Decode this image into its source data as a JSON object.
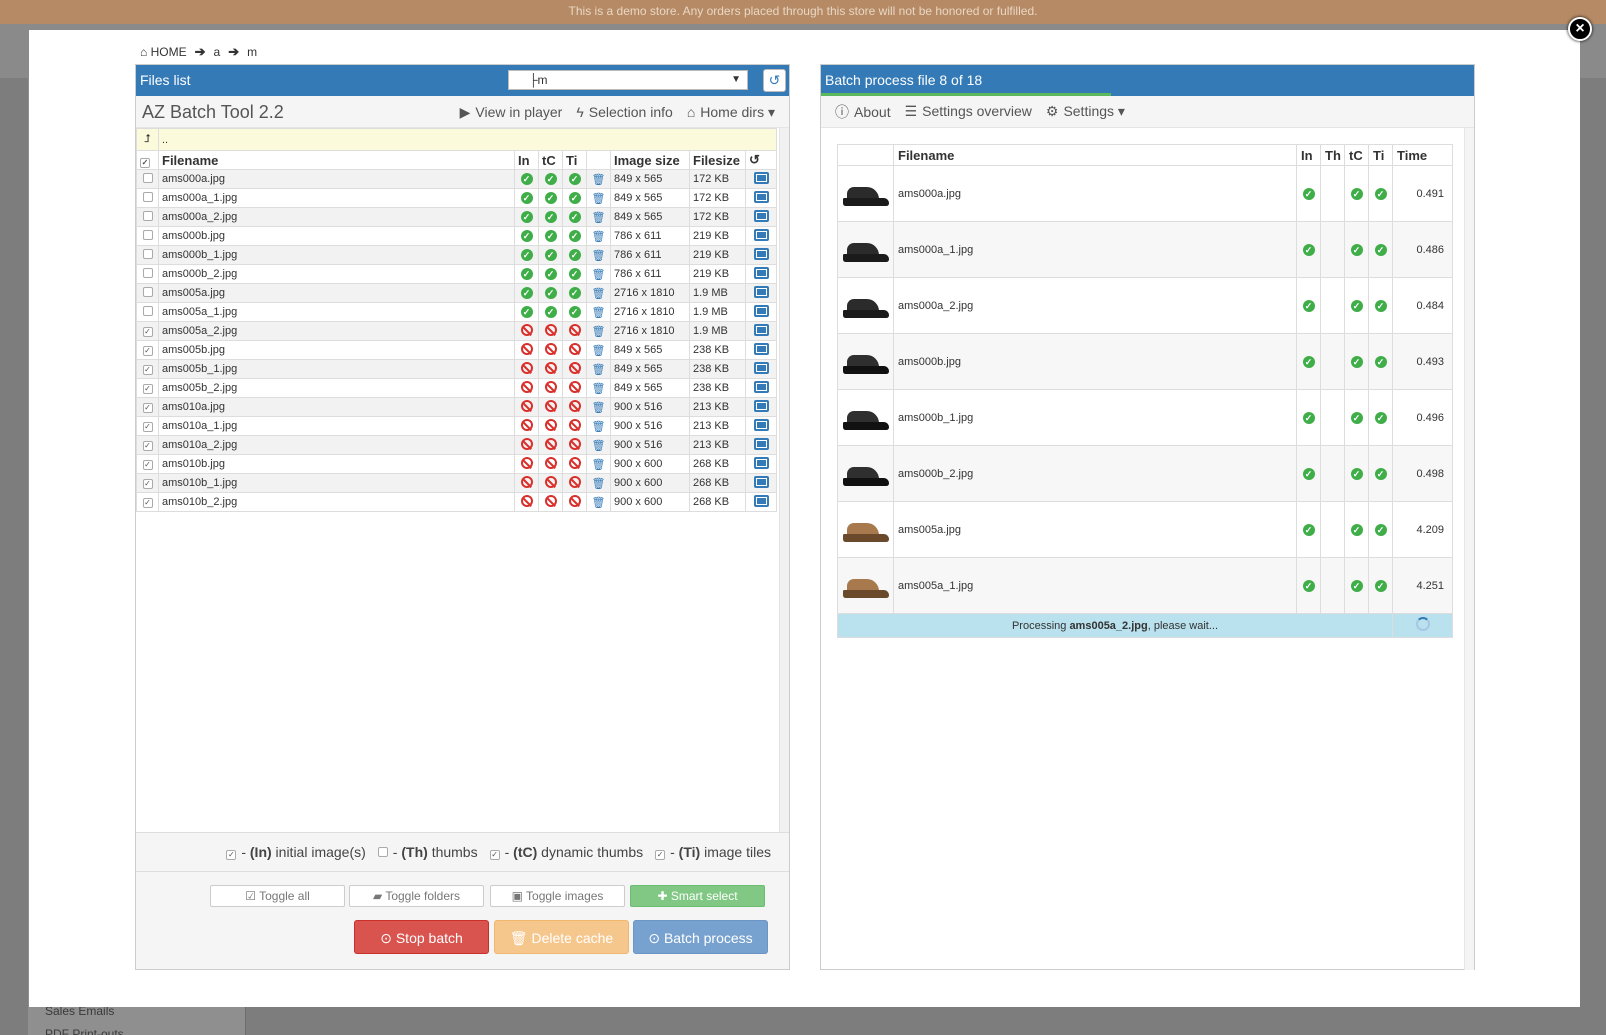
{
  "banner": "This is a demo store. Any orders placed through this store will not be honored or fulfilled.",
  "background_sidebar": [
    "Sales Emails",
    "PDF Print-outs"
  ],
  "breadcrumb": {
    "home": "HOME",
    "parts": [
      "a",
      "m"
    ]
  },
  "files_panel": {
    "title": "Files list",
    "dir_value": "├m",
    "app_title": "AZ Batch Tool 2.2",
    "links": {
      "view": "View in player",
      "selection": "Selection info",
      "home": "Home dirs"
    },
    "up_label": "..",
    "columns": {
      "filename": "Filename",
      "in": "In",
      "tc": "tC",
      "ti": "Ti",
      "size": "Image size",
      "filesize": "Filesize"
    },
    "files": [
      {
        "name": "ams000a.jpg",
        "checked": false,
        "done": true,
        "size": "849 x 565",
        "filesize": "172 KB"
      },
      {
        "name": "ams000a_1.jpg",
        "checked": false,
        "done": true,
        "size": "849 x 565",
        "filesize": "172 KB"
      },
      {
        "name": "ams000a_2.jpg",
        "checked": false,
        "done": true,
        "size": "849 x 565",
        "filesize": "172 KB"
      },
      {
        "name": "ams000b.jpg",
        "checked": false,
        "done": true,
        "size": "786 x 611",
        "filesize": "219 KB"
      },
      {
        "name": "ams000b_1.jpg",
        "checked": false,
        "done": true,
        "size": "786 x 611",
        "filesize": "219 KB"
      },
      {
        "name": "ams000b_2.jpg",
        "checked": false,
        "done": true,
        "size": "786 x 611",
        "filesize": "219 KB"
      },
      {
        "name": "ams005a.jpg",
        "checked": false,
        "done": true,
        "size": "2716 x 1810",
        "filesize": "1.9 MB"
      },
      {
        "name": "ams005a_1.jpg",
        "checked": false,
        "done": true,
        "size": "2716 x 1810",
        "filesize": "1.9 MB"
      },
      {
        "name": "ams005a_2.jpg",
        "checked": true,
        "done": false,
        "size": "2716 x 1810",
        "filesize": "1.9 MB"
      },
      {
        "name": "ams005b.jpg",
        "checked": true,
        "done": false,
        "size": "849 x 565",
        "filesize": "238 KB"
      },
      {
        "name": "ams005b_1.jpg",
        "checked": true,
        "done": false,
        "size": "849 x 565",
        "filesize": "238 KB"
      },
      {
        "name": "ams005b_2.jpg",
        "checked": true,
        "done": false,
        "size": "849 x 565",
        "filesize": "238 KB"
      },
      {
        "name": "ams010a.jpg",
        "checked": true,
        "done": false,
        "size": "900 x 516",
        "filesize": "213 KB"
      },
      {
        "name": "ams010a_1.jpg",
        "checked": true,
        "done": false,
        "size": "900 x 516",
        "filesize": "213 KB"
      },
      {
        "name": "ams010a_2.jpg",
        "checked": true,
        "done": false,
        "size": "900 x 516",
        "filesize": "213 KB"
      },
      {
        "name": "ams010b.jpg",
        "checked": true,
        "done": false,
        "size": "900 x 600",
        "filesize": "268 KB"
      },
      {
        "name": "ams010b_1.jpg",
        "checked": true,
        "done": false,
        "size": "900 x 600",
        "filesize": "268 KB"
      },
      {
        "name": "ams010b_2.jpg",
        "checked": true,
        "done": false,
        "size": "900 x 600",
        "filesize": "268 KB"
      }
    ],
    "legend": [
      {
        "checked": true,
        "code": "(In)",
        "text": "initial image(s)"
      },
      {
        "checked": false,
        "code": "(Th)",
        "text": "thumbs"
      },
      {
        "checked": true,
        "code": "(tC)",
        "text": "dynamic thumbs"
      },
      {
        "checked": true,
        "code": "(Ti)",
        "text": "image tiles"
      }
    ],
    "buttons": {
      "toggle_all": "Toggle all",
      "toggle_folders": "Toggle folders",
      "toggle_images": "Toggle images",
      "smart_select": "Smart select",
      "stop_batch": "Stop batch",
      "delete_cache": "Delete cache",
      "batch_process": "Batch process"
    }
  },
  "batch_panel": {
    "title": "Batch process file 8 of 18",
    "progress": 0.444,
    "links": {
      "about": "About",
      "overview": "Settings overview",
      "settings": "Settings"
    },
    "columns": {
      "filename": "Filename",
      "in": "In",
      "th": "Th",
      "tc": "tC",
      "ti": "Ti",
      "time": "Time"
    },
    "rows": [
      {
        "name": "ams000a.jpg",
        "time": "0.491",
        "shoe": "black-side"
      },
      {
        "name": "ams000a_1.jpg",
        "time": "0.486",
        "shoe": "black-side"
      },
      {
        "name": "ams000a_2.jpg",
        "time": "0.484",
        "shoe": "black-side"
      },
      {
        "name": "ams000b.jpg",
        "time": "0.493",
        "shoe": "black-angle"
      },
      {
        "name": "ams000b_1.jpg",
        "time": "0.496",
        "shoe": "black-angle"
      },
      {
        "name": "ams000b_2.jpg",
        "time": "0.498",
        "shoe": "black-angle"
      },
      {
        "name": "ams005a.jpg",
        "time": "4.209",
        "shoe": "brown"
      },
      {
        "name": "ams005a_1.jpg",
        "time": "4.251",
        "shoe": "brown"
      }
    ],
    "status": {
      "prefix": "Processing ",
      "file": "ams005a_2.jpg",
      "suffix": ", please wait..."
    }
  },
  "colors": {
    "primary": "#337ab7",
    "success": "#3fae49",
    "danger": "#d9534f",
    "warning": "#f6c78c",
    "info": "#b9e2ee"
  }
}
